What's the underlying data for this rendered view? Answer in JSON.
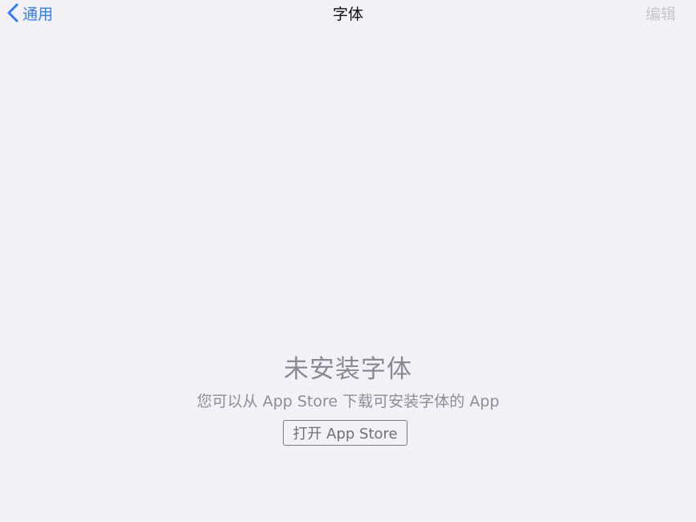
{
  "nav": {
    "back_label": "通用",
    "title": "字体",
    "edit_label": "编辑",
    "back_icon": "chevron-left-icon",
    "accent_color": "#2f7cf6"
  },
  "empty_state": {
    "title": "未安装字体",
    "message": "您可以从 App Store 下载可安装字体的 App",
    "button_label": "打开 App Store"
  },
  "colors": {
    "background": "#f2f1f6",
    "muted_text": "#8e8d93",
    "disabled_text": "#c6c6cb"
  }
}
